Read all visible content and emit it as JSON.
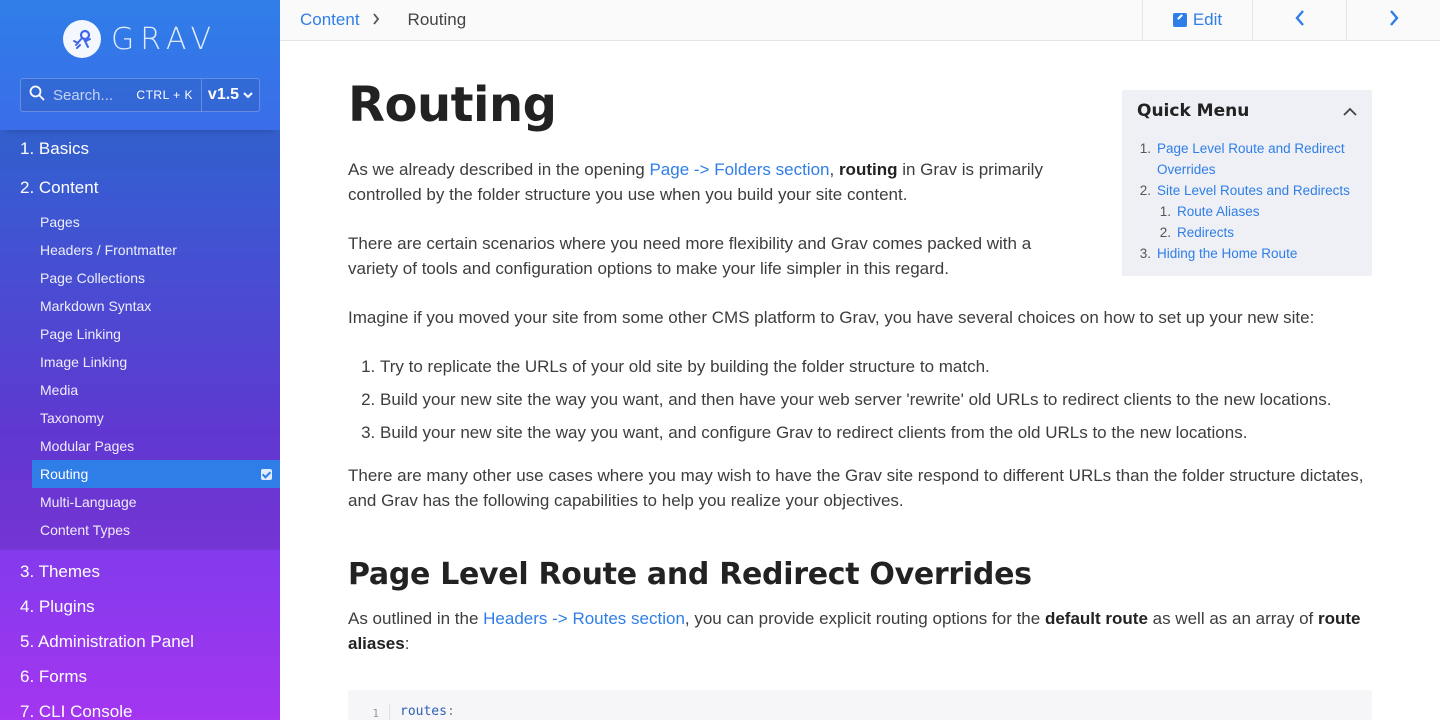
{
  "brand": {
    "name": "GRAV"
  },
  "search": {
    "placeholder": "Search...",
    "shortcut": "CTRL + K",
    "version": "v1.5"
  },
  "sidebar": {
    "top_items": [
      "1. Basics"
    ],
    "current_section": {
      "label": "2. Content",
      "items": [
        "Pages",
        "Headers / Frontmatter",
        "Page Collections",
        "Markdown Syntax",
        "Page Linking",
        "Image Linking",
        "Media",
        "Taxonomy",
        "Modular Pages",
        "Routing",
        "Multi-Language",
        "Content Types"
      ],
      "active_item": "Routing"
    },
    "lower_items": [
      "3. Themes",
      "4. Plugins",
      "5. Administration Panel",
      "6. Forms",
      "7. CLI Console"
    ]
  },
  "topbar": {
    "breadcrumb_parent": "Content",
    "breadcrumb_current": "Routing",
    "edit_label": "Edit"
  },
  "content": {
    "title": "Routing",
    "p1_a": "As we already described in the opening ",
    "p1_link": "Page -> Folders section",
    "p1_b": ", ",
    "p1_bold": "routing",
    "p1_c": " in Grav is primarily controlled by the folder structure you use when you build your site content.",
    "p2": "There are certain scenarios where you need more flexibility and Grav comes packed with a variety of tools and configuration options to make your life simpler in this regard.",
    "p3": "Imagine if you moved your site from some other CMS platform to Grav, you have several choices on how to set up your new site:",
    "steps": [
      "Try to replicate the URLs of your old site by building the folder structure to match.",
      "Build your new site the way you want, and then have your web server 'rewrite' old URLs to redirect clients to the new locations.",
      "Build your new site the way you want, and configure Grav to redirect clients from the old URLs to the new locations."
    ],
    "p4": "There are many other use cases where you may wish to have the Grav site respond to different URLs than the folder structure dictates, and Grav has the following capabilities to help you realize your objectives.",
    "h2": "Page Level Route and Redirect Overrides",
    "p5_a": "As outlined in the ",
    "p5_link": "Headers -> Routes section",
    "p5_b": ", you can provide explicit routing options for the ",
    "p5_bold1": "default route",
    "p5_c": " as well as an array of ",
    "p5_bold2": "route aliases",
    "p5_d": ":",
    "code_line_number": "1",
    "code_key": "routes",
    "code_colon": ":"
  },
  "quick_menu": {
    "title": "Quick Menu",
    "items": [
      {
        "num": "1.",
        "label": "Page Level Route and Redirect Overrides",
        "level": 1
      },
      {
        "num": "2.",
        "label": "Site Level Routes and Redirects",
        "level": 1
      },
      {
        "num": "1.",
        "label": "Route Aliases",
        "level": 2
      },
      {
        "num": "2.",
        "label": "Redirects",
        "level": 2
      },
      {
        "num": "3.",
        "label": "Hiding the Home Route",
        "level": 1
      }
    ]
  }
}
